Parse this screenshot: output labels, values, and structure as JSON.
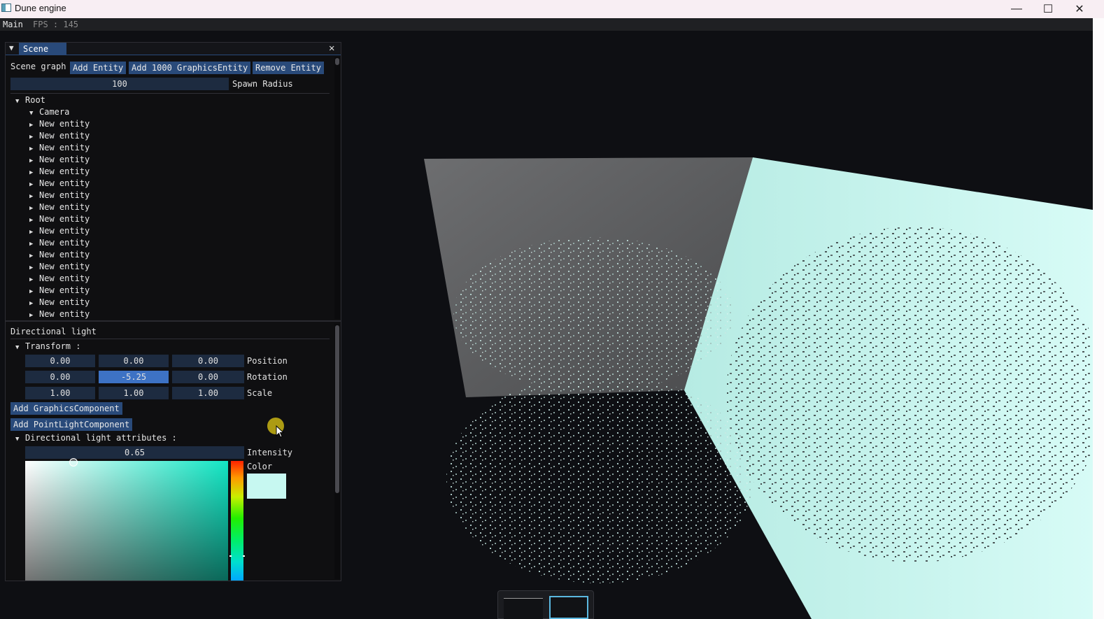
{
  "window": {
    "title": "Dune engine"
  },
  "menubar": {
    "main": "Main",
    "fps": "FPS : 145"
  },
  "panel": {
    "tab": "Scene",
    "scene_graph_label": "Scene graph",
    "add_entity": "Add Entity",
    "add_1000": "Add 1000 GraphicsEntity",
    "remove_entity": "Remove Entity",
    "spawn_radius_value": "100",
    "spawn_radius_label": "Spawn Radius",
    "tree": {
      "root": "Root",
      "camera": "Camera",
      "entities": [
        "New entity",
        "New entity",
        "New entity",
        "New entity",
        "New entity",
        "New entity",
        "New entity",
        "New entity",
        "New entity",
        "New entity",
        "New entity",
        "New entity",
        "New entity",
        "New entity",
        "New entity",
        "New entity",
        "New entity"
      ]
    },
    "inspector": {
      "name": "Directional light",
      "transform_header": "Transform :",
      "position": {
        "label": "Position",
        "x": "0.00",
        "y": "0.00",
        "z": "0.00"
      },
      "rotation": {
        "label": "Rotation",
        "x": "0.00",
        "y": "-5.25",
        "z": "0.00"
      },
      "scale": {
        "label": "Scale",
        "x": "1.00",
        "y": "1.00",
        "z": "1.00"
      },
      "add_graphics": "Add GraphicsComponent",
      "add_pointlight": "Add PointLightComponent",
      "light_header": "Directional light attributes :",
      "intensity": {
        "label": "Intensity",
        "value": "0.65"
      },
      "color": {
        "label": "Color",
        "hex": "#c7f8f1"
      }
    }
  },
  "colors": {
    "accent": "#294a7a",
    "active_field": "#3d72c4",
    "light_color": "#c7f8f1"
  }
}
